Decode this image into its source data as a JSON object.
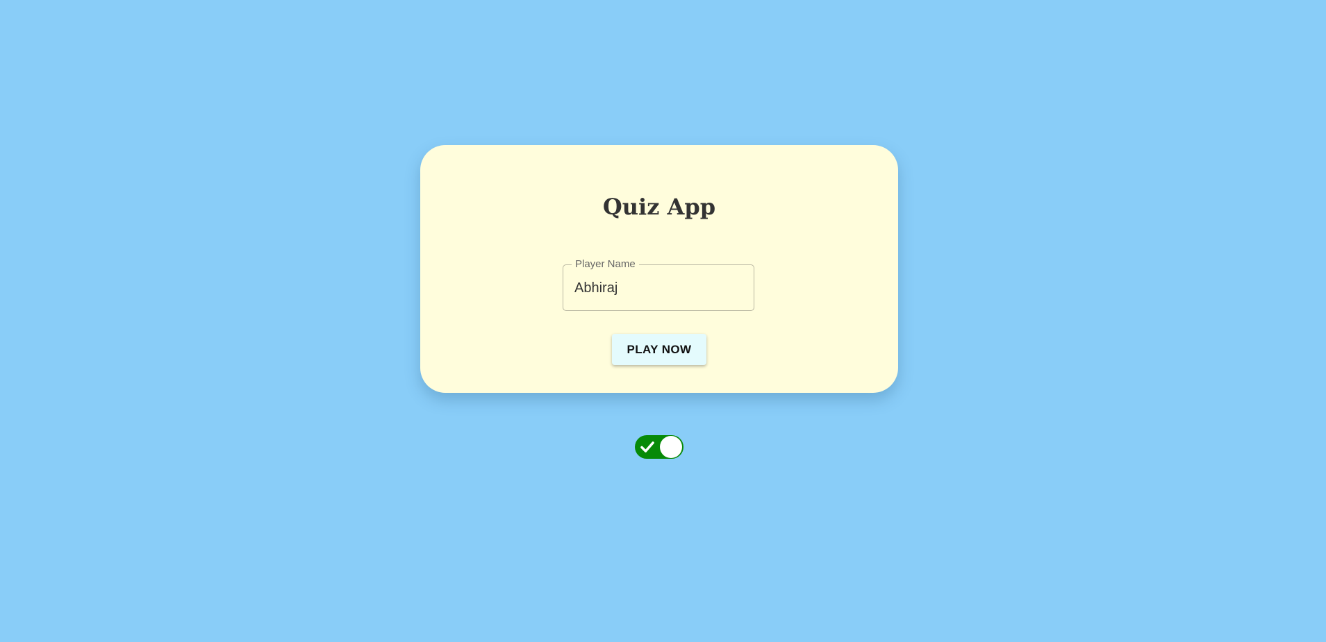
{
  "app": {
    "title": "Quiz App"
  },
  "form": {
    "player_name_label": "Player Name",
    "player_name_value": "Abhiraj",
    "play_button_label": "PLAY NOW"
  },
  "toggle": {
    "state": "on",
    "icon": "check-icon",
    "color_on": "#078a07"
  },
  "colors": {
    "background": "#89cdf8",
    "card": "#fffddc",
    "button": "#e4fbfd"
  }
}
